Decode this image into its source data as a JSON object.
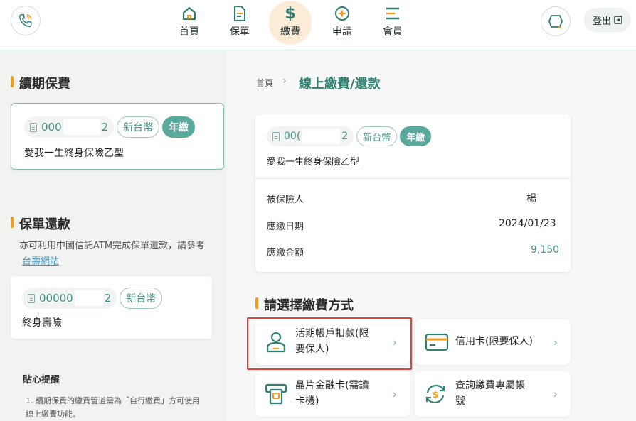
{
  "header": {
    "nav": [
      {
        "label": "首頁",
        "icon": "home-icon"
      },
      {
        "label": "保單",
        "icon": "document-icon"
      },
      {
        "label": "繳費",
        "icon": "dollar-icon"
      },
      {
        "label": "申請",
        "icon": "plus-circle-icon"
      },
      {
        "label": "會員",
        "icon": "menu-icon"
      }
    ],
    "active": "繳費",
    "logout_label": "登出"
  },
  "left": {
    "renewal": {
      "title": "續期保費",
      "policy_prefix": "000",
      "policy_suffix": "2",
      "currency": "新台幣",
      "frequency": "年繳",
      "product": "愛我一生終身保險乙型"
    },
    "loan": {
      "title": "保單還款",
      "desc": "亦可利用中國信託ATM完成保單還款，請參考",
      "link": "台壽網站",
      "policy_prefix": "00000",
      "policy_suffix": "2",
      "currency": "新台幣",
      "product": "終身壽險"
    },
    "tips": {
      "title": "貼心提醒",
      "item1": "1.  續期保費的繳費管道需為「自行繳費」方可使用線上繳費功能。"
    }
  },
  "main": {
    "breadcrumb_home": "首頁",
    "breadcrumb_sep": "›",
    "title": "線上繳費/還款",
    "policy_card": {
      "policy_prefix": "00(",
      "policy_suffix": "2",
      "currency": "新台幣",
      "frequency": "年繳",
      "product": "愛我一生終身保險乙型",
      "insured_label": "被保險人",
      "insured_value": "楊",
      "due_label": "應繳日期",
      "due_value": "2024/01/23",
      "amount_label": "應繳金額",
      "amount_value": "9,150"
    },
    "method_title": "請選擇繳費方式",
    "methods": [
      {
        "label_l1": "活期帳戶扣款(限",
        "label_l2": "要保人)",
        "icon": "account-user-icon"
      },
      {
        "label_l1": "信用卡(限要保人)",
        "label_l2": "",
        "icon": "credit-card-icon"
      },
      {
        "label_l1": "晶片金融卡(需讀",
        "label_l2": "卡機)",
        "icon": "chip-card-reader-icon"
      },
      {
        "label_l1": "查詢繳費專屬帳",
        "label_l2": "號",
        "icon": "refresh-dollar-icon"
      }
    ]
  },
  "colors": {
    "accent": "#5aa99d",
    "brand_orange": "#f39a1f",
    "highlight": "#e3403a",
    "title_green": "#2f7f73"
  }
}
